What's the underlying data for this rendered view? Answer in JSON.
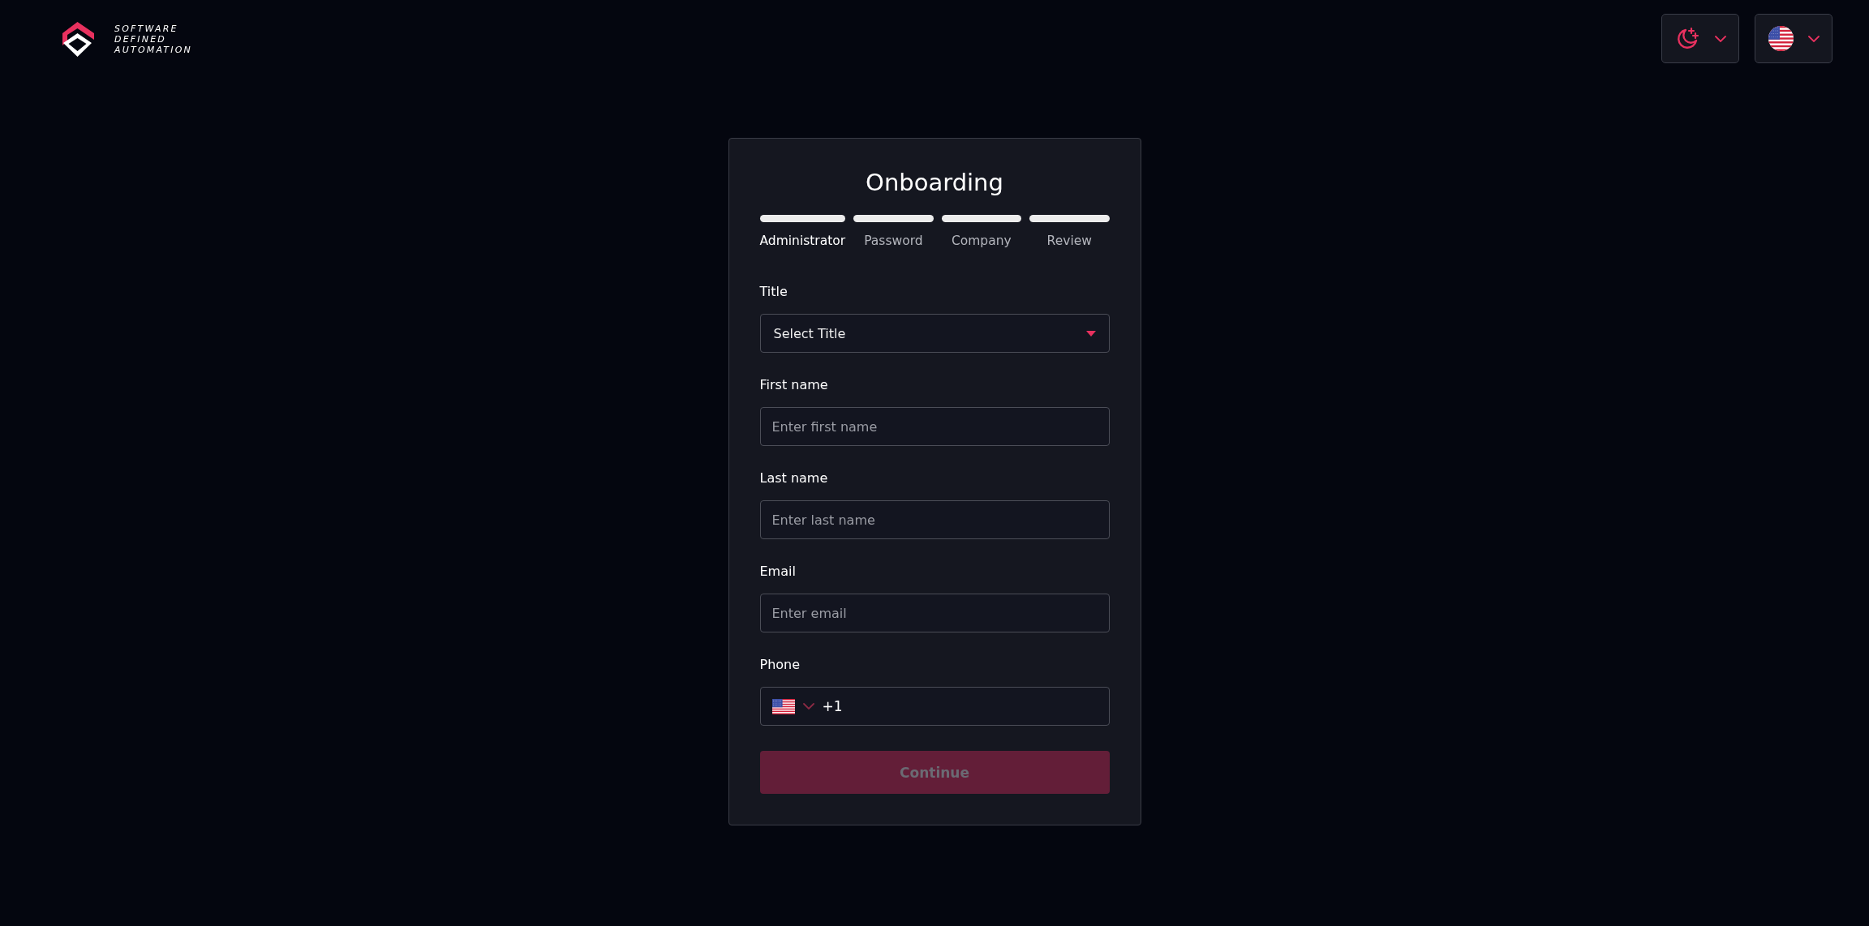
{
  "brand": {
    "name_lines": [
      "SOFTWARE",
      "DEFINED",
      "AUTOMATION"
    ]
  },
  "header_controls": [
    {
      "kind": "theme",
      "dark": true
    },
    {
      "kind": "language"
    }
  ],
  "card": {
    "title": "Onboarding",
    "steps": [
      {
        "label": "Administrator",
        "selected": true
      },
      {
        "label": "Password",
        "selected": false
      },
      {
        "label": "Company",
        "selected": false
      },
      {
        "label": "Review",
        "selected": false
      }
    ],
    "fields": [
      {
        "kind": "select",
        "label": "Title",
        "placeholder": "Select Title"
      },
      {
        "kind": "text",
        "label": "First name",
        "placeholder": "Enter first name"
      },
      {
        "kind": "text",
        "label": "Last name",
        "placeholder": "Enter last name"
      },
      {
        "kind": "text",
        "label": "Email",
        "placeholder": "Enter email"
      },
      {
        "kind": "phone",
        "label": "Phone",
        "value": "+1"
      }
    ],
    "continue_button": {
      "label": "Continue",
      "disabled": true
    }
  }
}
